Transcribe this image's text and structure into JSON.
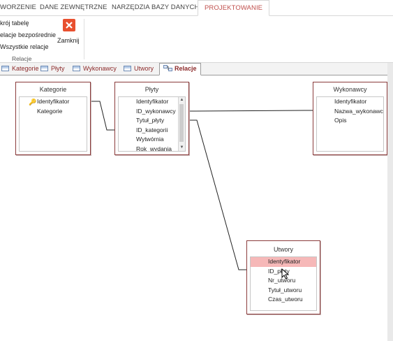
{
  "ribbon_tabs": [
    {
      "label": "WORZENIE"
    },
    {
      "label": "DANE ZEWNĘTRZNE"
    },
    {
      "label": "NARZĘDZIA BAZY DANYCH"
    },
    {
      "label": "PROJEKTOWANIE"
    }
  ],
  "ribbon": {
    "commands": [
      "krój tabelę",
      "elacje bezpośrednie",
      "Wszystkie relacje"
    ],
    "close_label": "Zamknij",
    "group_label": "Relacje"
  },
  "doc_tabs": [
    {
      "label": "Kategorie"
    },
    {
      "label": "Płyty"
    },
    {
      "label": "Wykonawcy"
    },
    {
      "label": "Utwory"
    },
    {
      "label": "Relacje"
    }
  ],
  "tables": {
    "kategorie": {
      "title": "Kategorie",
      "fields": [
        "Identyfikator",
        "Kategorie"
      ],
      "key_field": "Identyfikator"
    },
    "plyty": {
      "title": "Płyty",
      "fields": [
        "Identyfikator",
        "ID_wykonawcy",
        "Tytuł_płyty",
        "ID_kategorii",
        "Wytwórnia",
        "Rok_wydania"
      ]
    },
    "wykonawcy": {
      "title": "Wykonawcy",
      "fields": [
        "Identyfikator",
        "Nazwa_wykonawcy",
        "Opis"
      ]
    },
    "utwory": {
      "title": "Utwory",
      "fields": [
        "Identyfikator",
        "ID_płyty",
        "Nr_utworu",
        "Tytuł_utworu",
        "Czas_utworu"
      ],
      "highlighted": "Identyfikator"
    }
  },
  "colors": {
    "accent": "#c0504d",
    "table_border": "#8a3b3b",
    "highlight_row": "#f6b8b8",
    "close_button": "#e8502f"
  },
  "icons": [
    "close-icon",
    "key-icon",
    "table-icon",
    "relationships-icon",
    "scroll-up-icon",
    "scroll-down-icon",
    "mouse-cursor-icon"
  ]
}
